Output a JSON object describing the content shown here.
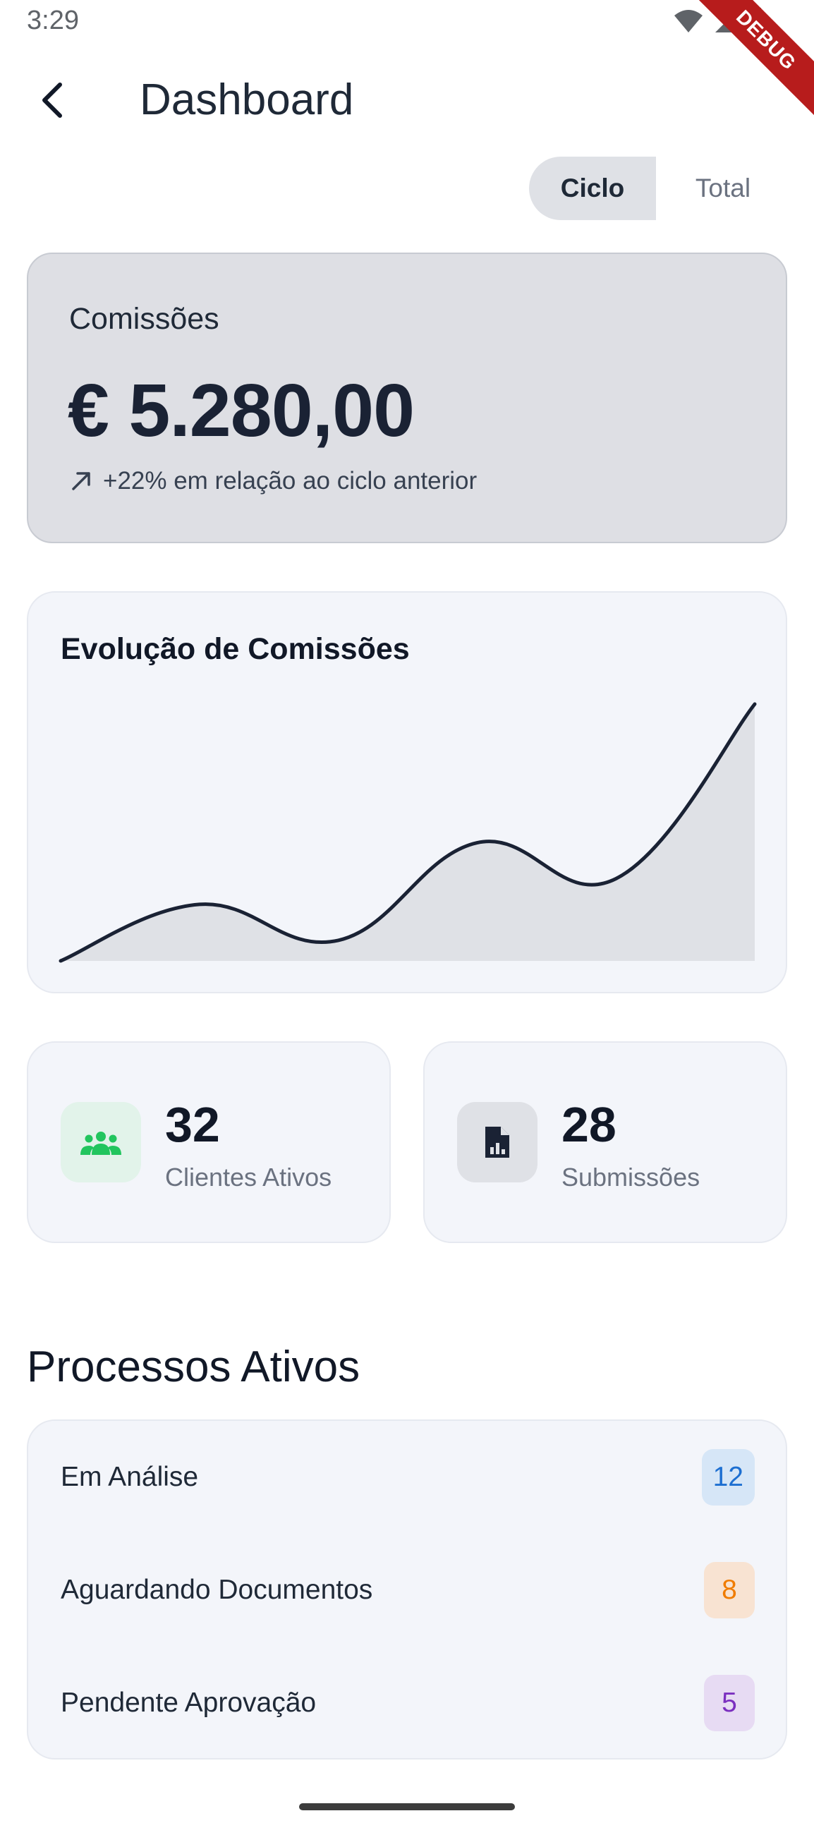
{
  "status_bar": {
    "time": "3:29",
    "debug_label": "DEBUG"
  },
  "header": {
    "title": "Dashboard"
  },
  "period_toggle": {
    "options": [
      "Ciclo",
      "Total"
    ],
    "selected": "Ciclo"
  },
  "commissions": {
    "label": "Comissões",
    "value": "€ 5.280,00",
    "trend_text": "+22% em relação ao ciclo anterior"
  },
  "evolution_chart": {
    "title": "Evolução de Comissões",
    "line_color": "#1a2234",
    "fill_color": "#dfe1e6"
  },
  "chart_data": {
    "type": "area",
    "title": "Evolução de Comissões",
    "xlabel": "",
    "ylabel": "",
    "x": [
      0,
      1,
      2,
      3,
      4,
      5
    ],
    "values": [
      0,
      22,
      8,
      46,
      32,
      100
    ],
    "ylim": [
      0,
      100
    ],
    "grid": false
  },
  "stats": [
    {
      "number": "32",
      "label": "Clientes Ativos",
      "icon": "people-icon",
      "icon_color": "#22c55e",
      "icon_bg": "#e2f3ea"
    },
    {
      "number": "28",
      "label": "Submissões",
      "icon": "document-chart-icon",
      "icon_color": "#1a2234",
      "icon_bg": "#dfe1e6"
    }
  ],
  "processes": {
    "title": "Processos Ativos",
    "items": [
      {
        "label": "Em Análise",
        "count": "12",
        "text_color": "#1d6fd1",
        "bg_color": "#d6e6f7"
      },
      {
        "label": "Aguardando Documentos",
        "count": "8",
        "text_color": "#f07c00",
        "bg_color": "#f8e3d2"
      },
      {
        "label": "Pendente Aprovação",
        "count": "5",
        "text_color": "#7b2fbf",
        "bg_color": "#e7dbf3"
      }
    ]
  }
}
